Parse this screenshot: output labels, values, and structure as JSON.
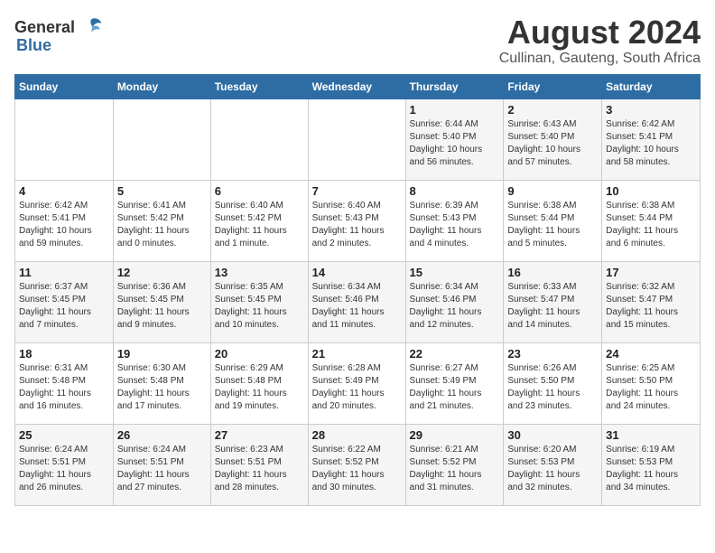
{
  "logo": {
    "text_general": "General",
    "text_blue": "Blue"
  },
  "title": "August 2024",
  "subtitle": "Cullinan, Gauteng, South Africa",
  "days_of_week": [
    "Sunday",
    "Monday",
    "Tuesday",
    "Wednesday",
    "Thursday",
    "Friday",
    "Saturday"
  ],
  "weeks": [
    [
      {
        "day": "",
        "info": ""
      },
      {
        "day": "",
        "info": ""
      },
      {
        "day": "",
        "info": ""
      },
      {
        "day": "",
        "info": ""
      },
      {
        "day": "1",
        "info": "Sunrise: 6:44 AM\nSunset: 5:40 PM\nDaylight: 10 hours\nand 56 minutes."
      },
      {
        "day": "2",
        "info": "Sunrise: 6:43 AM\nSunset: 5:40 PM\nDaylight: 10 hours\nand 57 minutes."
      },
      {
        "day": "3",
        "info": "Sunrise: 6:42 AM\nSunset: 5:41 PM\nDaylight: 10 hours\nand 58 minutes."
      }
    ],
    [
      {
        "day": "4",
        "info": "Sunrise: 6:42 AM\nSunset: 5:41 PM\nDaylight: 10 hours\nand 59 minutes."
      },
      {
        "day": "5",
        "info": "Sunrise: 6:41 AM\nSunset: 5:42 PM\nDaylight: 11 hours\nand 0 minutes."
      },
      {
        "day": "6",
        "info": "Sunrise: 6:40 AM\nSunset: 5:42 PM\nDaylight: 11 hours\nand 1 minute."
      },
      {
        "day": "7",
        "info": "Sunrise: 6:40 AM\nSunset: 5:43 PM\nDaylight: 11 hours\nand 2 minutes."
      },
      {
        "day": "8",
        "info": "Sunrise: 6:39 AM\nSunset: 5:43 PM\nDaylight: 11 hours\nand 4 minutes."
      },
      {
        "day": "9",
        "info": "Sunrise: 6:38 AM\nSunset: 5:44 PM\nDaylight: 11 hours\nand 5 minutes."
      },
      {
        "day": "10",
        "info": "Sunrise: 6:38 AM\nSunset: 5:44 PM\nDaylight: 11 hours\nand 6 minutes."
      }
    ],
    [
      {
        "day": "11",
        "info": "Sunrise: 6:37 AM\nSunset: 5:45 PM\nDaylight: 11 hours\nand 7 minutes."
      },
      {
        "day": "12",
        "info": "Sunrise: 6:36 AM\nSunset: 5:45 PM\nDaylight: 11 hours\nand 9 minutes."
      },
      {
        "day": "13",
        "info": "Sunrise: 6:35 AM\nSunset: 5:45 PM\nDaylight: 11 hours\nand 10 minutes."
      },
      {
        "day": "14",
        "info": "Sunrise: 6:34 AM\nSunset: 5:46 PM\nDaylight: 11 hours\nand 11 minutes."
      },
      {
        "day": "15",
        "info": "Sunrise: 6:34 AM\nSunset: 5:46 PM\nDaylight: 11 hours\nand 12 minutes."
      },
      {
        "day": "16",
        "info": "Sunrise: 6:33 AM\nSunset: 5:47 PM\nDaylight: 11 hours\nand 14 minutes."
      },
      {
        "day": "17",
        "info": "Sunrise: 6:32 AM\nSunset: 5:47 PM\nDaylight: 11 hours\nand 15 minutes."
      }
    ],
    [
      {
        "day": "18",
        "info": "Sunrise: 6:31 AM\nSunset: 5:48 PM\nDaylight: 11 hours\nand 16 minutes."
      },
      {
        "day": "19",
        "info": "Sunrise: 6:30 AM\nSunset: 5:48 PM\nDaylight: 11 hours\nand 17 minutes."
      },
      {
        "day": "20",
        "info": "Sunrise: 6:29 AM\nSunset: 5:48 PM\nDaylight: 11 hours\nand 19 minutes."
      },
      {
        "day": "21",
        "info": "Sunrise: 6:28 AM\nSunset: 5:49 PM\nDaylight: 11 hours\nand 20 minutes."
      },
      {
        "day": "22",
        "info": "Sunrise: 6:27 AM\nSunset: 5:49 PM\nDaylight: 11 hours\nand 21 minutes."
      },
      {
        "day": "23",
        "info": "Sunrise: 6:26 AM\nSunset: 5:50 PM\nDaylight: 11 hours\nand 23 minutes."
      },
      {
        "day": "24",
        "info": "Sunrise: 6:25 AM\nSunset: 5:50 PM\nDaylight: 11 hours\nand 24 minutes."
      }
    ],
    [
      {
        "day": "25",
        "info": "Sunrise: 6:24 AM\nSunset: 5:51 PM\nDaylight: 11 hours\nand 26 minutes."
      },
      {
        "day": "26",
        "info": "Sunrise: 6:24 AM\nSunset: 5:51 PM\nDaylight: 11 hours\nand 27 minutes."
      },
      {
        "day": "27",
        "info": "Sunrise: 6:23 AM\nSunset: 5:51 PM\nDaylight: 11 hours\nand 28 minutes."
      },
      {
        "day": "28",
        "info": "Sunrise: 6:22 AM\nSunset: 5:52 PM\nDaylight: 11 hours\nand 30 minutes."
      },
      {
        "day": "29",
        "info": "Sunrise: 6:21 AM\nSunset: 5:52 PM\nDaylight: 11 hours\nand 31 minutes."
      },
      {
        "day": "30",
        "info": "Sunrise: 6:20 AM\nSunset: 5:53 PM\nDaylight: 11 hours\nand 32 minutes."
      },
      {
        "day": "31",
        "info": "Sunrise: 6:19 AM\nSunset: 5:53 PM\nDaylight: 11 hours\nand 34 minutes."
      }
    ]
  ]
}
